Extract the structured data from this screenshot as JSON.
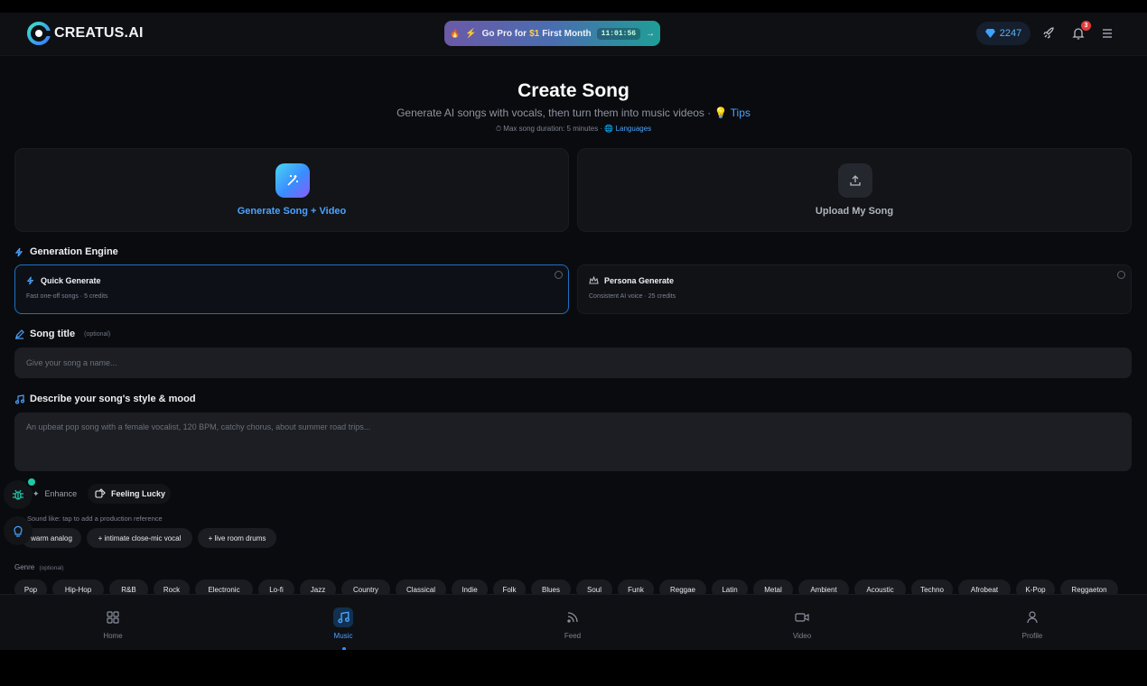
{
  "header": {
    "brand": "CREATUS.AI",
    "promo_text": "Go Pro for",
    "promo_price": "$1",
    "promo_suffix": "First Month",
    "promo_timer": "11:01:56",
    "credits": "2247",
    "notification_count": "3"
  },
  "hero": {
    "title": "Create Song",
    "subtitle": "Generate AI songs with vocals, then turn them into music videos ·",
    "tips_label": "Tips",
    "duration_text": "Max song duration: 5 minutes ·",
    "languages_label": "Languages"
  },
  "modes": [
    {
      "label": "Generate Song + Video",
      "icon": "magic-wand-icon",
      "active": true
    },
    {
      "label": "Upload My Song",
      "icon": "upload-icon",
      "active": false
    }
  ],
  "engine": {
    "section_label": "Generation Engine",
    "options": [
      {
        "name": "Quick Generate",
        "desc": "Fast one-off songs · 5 credits",
        "selected": true
      },
      {
        "name": "Persona Generate",
        "desc": "Consistent AI voice · 25 credits",
        "selected": false
      }
    ]
  },
  "song_title": {
    "label": "Song title",
    "optional": "(optional)",
    "placeholder": "Give your song a name..."
  },
  "style": {
    "label": "Describe your song's style & mood",
    "placeholder": "An upbeat pop song with a female vocalist, 120 BPM, catchy chorus, about summer road trips..."
  },
  "actions": {
    "enhance": "Enhance",
    "feeling_lucky": "Feeling Lucky"
  },
  "sound_like": {
    "label": "Sound like: tap to add a production reference",
    "chips": [
      "warm analog",
      "+ intimate close-mic vocal",
      "+ live room drums"
    ]
  },
  "genre": {
    "label": "Genre",
    "optional": "(optional)",
    "chips": [
      "Pop",
      "Hip-Hop",
      "R&B",
      "Rock",
      "Electronic",
      "Lo-fi",
      "Jazz",
      "Country",
      "Classical",
      "Indie",
      "Folk",
      "Blues",
      "Soul",
      "Funk",
      "Reggae",
      "Latin",
      "Metal",
      "Ambient",
      "Acoustic",
      "Techno",
      "Afrobeat",
      "K-Pop",
      "Reggaeton"
    ]
  },
  "nav": [
    {
      "label": "Home",
      "icon": "grid-icon"
    },
    {
      "label": "Music",
      "icon": "music-note-icon",
      "active": true
    },
    {
      "label": "Feed",
      "icon": "rss-icon"
    },
    {
      "label": "Video",
      "icon": "video-camera-icon"
    },
    {
      "label": "Profile",
      "icon": "user-icon"
    }
  ],
  "colors": {
    "accent": "#4aa3ff",
    "background": "#0a0b0e",
    "surface": "#121418"
  }
}
